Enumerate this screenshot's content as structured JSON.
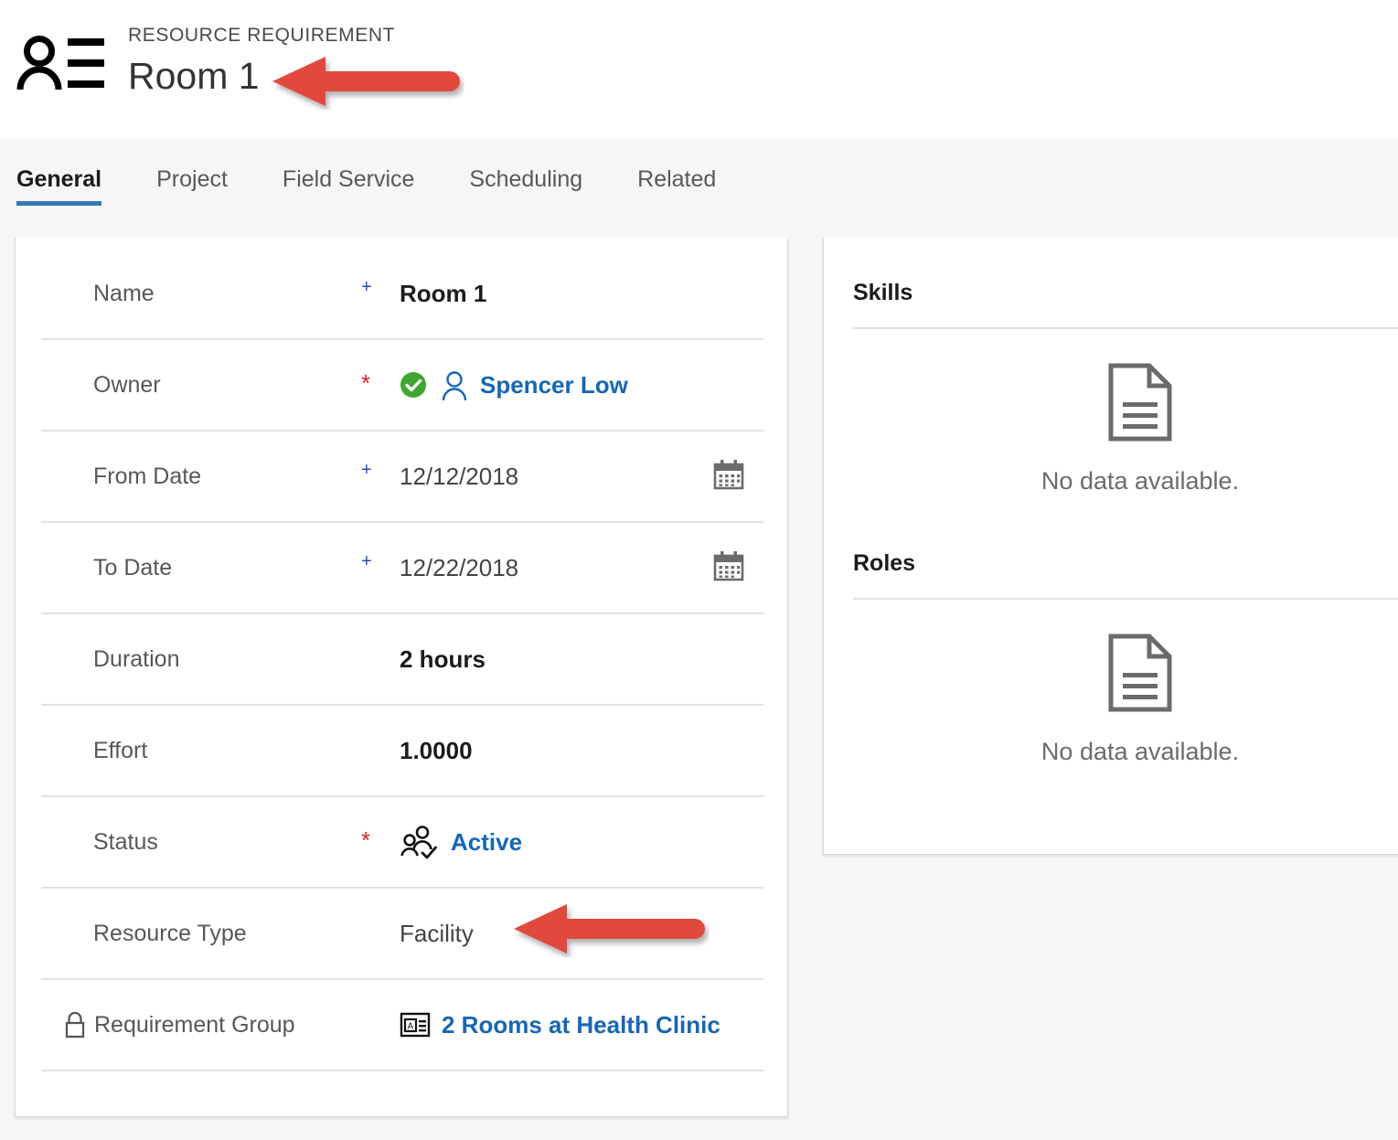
{
  "header": {
    "icon": "contact-card-icon",
    "entity_type": "RESOURCE REQUIREMENT",
    "record_title": "Room 1"
  },
  "tabs": [
    {
      "label": "General",
      "active": true
    },
    {
      "label": "Project",
      "active": false
    },
    {
      "label": "Field Service",
      "active": false
    },
    {
      "label": "Scheduling",
      "active": false
    },
    {
      "label": "Related",
      "active": false
    }
  ],
  "form": {
    "fields": [
      {
        "label": "Name",
        "marker": "+",
        "value": "Room 1",
        "style": "bold",
        "icon": null,
        "calendar": false,
        "locked": false
      },
      {
        "label": "Owner",
        "marker": "*",
        "value": "Spencer Low",
        "style": "link",
        "icon": "user-outline-icon",
        "status_icon": "green-check-icon",
        "calendar": false,
        "locked": false
      },
      {
        "label": "From Date",
        "marker": "+",
        "value": "12/12/2018",
        "style": "plain",
        "icon": null,
        "calendar": true,
        "locked": false
      },
      {
        "label": "To Date",
        "marker": "+",
        "value": "12/22/2018",
        "style": "plain",
        "icon": null,
        "calendar": true,
        "locked": false
      },
      {
        "label": "Duration",
        "marker": "",
        "value": "2 hours",
        "style": "bold",
        "icon": null,
        "calendar": false,
        "locked": false
      },
      {
        "label": "Effort",
        "marker": "",
        "value": "1.0000",
        "style": "bold",
        "icon": null,
        "calendar": false,
        "locked": false
      },
      {
        "label": "Status",
        "marker": "*",
        "value": "Active",
        "style": "link",
        "icon": "people-check-icon",
        "calendar": false,
        "locked": false
      },
      {
        "label": "Resource Type",
        "marker": "",
        "value": "Facility",
        "style": "plain",
        "icon": null,
        "calendar": false,
        "locked": false
      },
      {
        "label": "Requirement Group",
        "marker": "",
        "value": "2 Rooms at Health Clinic",
        "style": "link",
        "icon": "requirement-group-icon",
        "calendar": false,
        "locked": true
      }
    ]
  },
  "right_panel": {
    "sections": [
      {
        "title": "Skills",
        "empty_text": "No data available.",
        "empty_icon": "document-icon"
      },
      {
        "title": "Roles",
        "empty_text": "No data available.",
        "empty_icon": "document-icon"
      }
    ]
  },
  "annotations": {
    "arrows": [
      {
        "name": "arrow-pointing-to-record-title",
        "color": "#e2493d"
      },
      {
        "name": "arrow-pointing-to-resource-type",
        "color": "#e2493d"
      }
    ]
  },
  "colors": {
    "accent_blue": "#3479b7",
    "link_blue": "#1666b8",
    "required_red": "#e02020",
    "recommended_blue": "#2b45c9",
    "success_green": "#3fa72f",
    "arrow_red": "#e2493d",
    "page_background": "#f7f6f5"
  }
}
